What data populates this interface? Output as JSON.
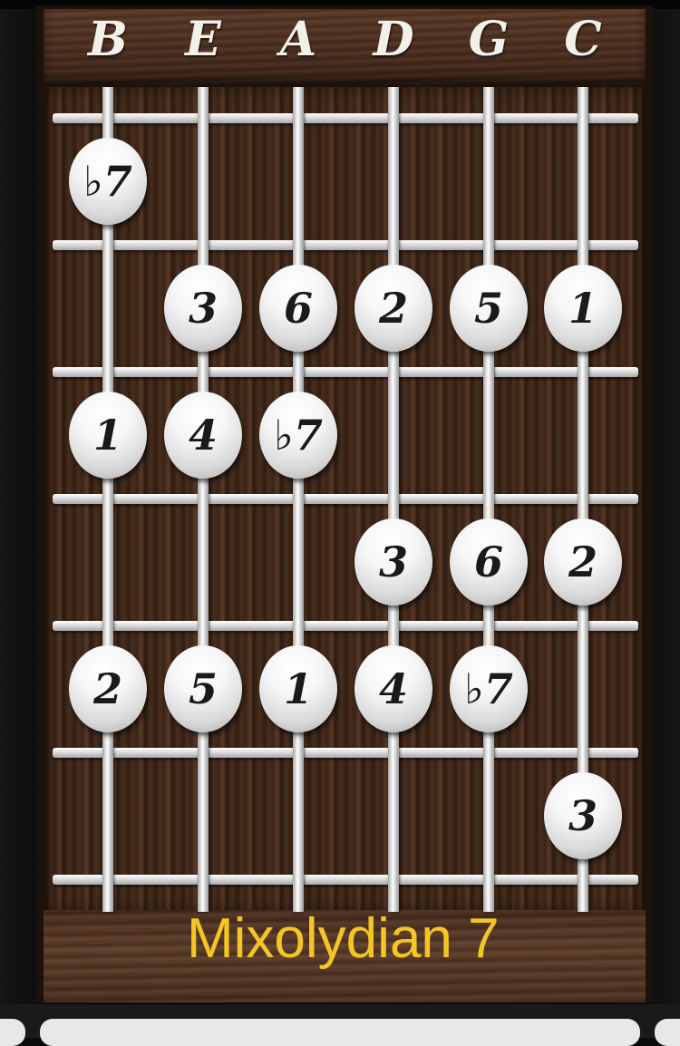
{
  "strings": [
    "B",
    "E",
    "A",
    "D",
    "G",
    "C"
  ],
  "caption": "Mixolydian 7",
  "notes": [
    {
      "string": 0,
      "fret": 1,
      "label": "♭7"
    },
    {
      "string": 1,
      "fret": 2,
      "label": "3"
    },
    {
      "string": 2,
      "fret": 2,
      "label": "6"
    },
    {
      "string": 3,
      "fret": 2,
      "label": "2"
    },
    {
      "string": 4,
      "fret": 2,
      "label": "5"
    },
    {
      "string": 5,
      "fret": 2,
      "label": "1"
    },
    {
      "string": 0,
      "fret": 3,
      "label": "1"
    },
    {
      "string": 1,
      "fret": 3,
      "label": "4"
    },
    {
      "string": 2,
      "fret": 3,
      "label": "♭7"
    },
    {
      "string": 3,
      "fret": 4,
      "label": "3"
    },
    {
      "string": 4,
      "fret": 4,
      "label": "6"
    },
    {
      "string": 5,
      "fret": 4,
      "label": "2"
    },
    {
      "string": 0,
      "fret": 5,
      "label": "2"
    },
    {
      "string": 1,
      "fret": 5,
      "label": "5"
    },
    {
      "string": 2,
      "fret": 5,
      "label": "1"
    },
    {
      "string": 3,
      "fret": 5,
      "label": "4"
    },
    {
      "string": 4,
      "fret": 5,
      "label": "♭7"
    },
    {
      "string": 5,
      "fret": 6,
      "label": "3"
    }
  ],
  "colors": {
    "caption": "#f3c623",
    "wood": "#3a2418"
  }
}
